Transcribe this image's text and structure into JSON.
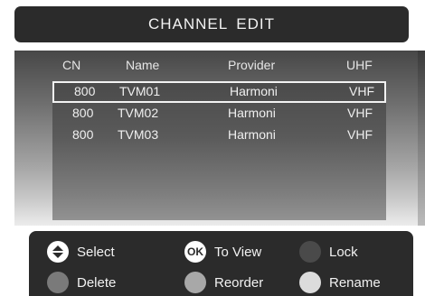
{
  "title": "CHANNEL  EDIT",
  "columns": {
    "cn": "CN",
    "name": "Name",
    "provider": "Provider",
    "band": "UHF"
  },
  "channels": [
    {
      "cn": "800",
      "name": "TVM01",
      "provider": "Harmoni",
      "band": "VHF",
      "selected": true
    },
    {
      "cn": "800",
      "name": "TVM02",
      "provider": "Harmoni",
      "band": "VHF",
      "selected": false
    },
    {
      "cn": "800",
      "name": "TVM03",
      "provider": "Harmoni",
      "band": "VHF",
      "selected": false
    }
  ],
  "footer": {
    "select": {
      "label": "Select",
      "icon": "up-down-arrow-icon",
      "color": "#ffffff"
    },
    "to_view": {
      "label": "To View",
      "icon_text": "OK",
      "icon": "ok-icon",
      "color": "#ffffff"
    },
    "lock": {
      "label": "Lock",
      "icon": "lock-button-icon",
      "color": "#4a4a4a"
    },
    "delete": {
      "label": "Delete",
      "icon": "delete-button-icon",
      "color": "#7a7a7a"
    },
    "reorder": {
      "label": "Reorder",
      "icon": "reorder-button-icon",
      "color": "#a8a8a8"
    },
    "rename": {
      "label": "Rename",
      "icon": "rename-button-icon",
      "color": "#dcdcdc"
    }
  }
}
